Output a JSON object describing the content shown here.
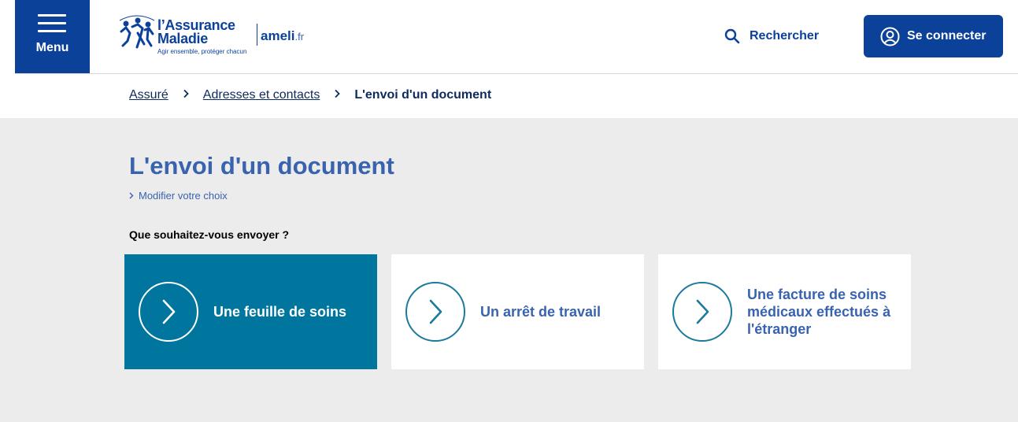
{
  "header": {
    "menu_label": "Menu",
    "logo": {
      "title_line1": "l’Assurance",
      "title_line2": "Maladie",
      "slogan": "Agir ensemble, protéger chacun",
      "ameli": "ameli",
      "ameli_suffix": ".fr"
    },
    "search_label": "Rechercher",
    "connect_label": "Se connecter"
  },
  "breadcrumb": {
    "items": [
      "Assuré",
      "Adresses et contacts"
    ],
    "current": "L'envoi d'un document"
  },
  "main": {
    "title": "L'envoi d'un document",
    "modify_link": "Modifier votre choix",
    "question": "Que souhaitez-vous envoyer ?",
    "cards": [
      {
        "label": "Une feuille de soins",
        "active": true
      },
      {
        "label": "Un arrêt de travail",
        "active": false
      },
      {
        "label": "Une facture de soins médicaux effectués à l'étranger",
        "active": false
      }
    ]
  },
  "colors": {
    "brand_blue": "#0c419a",
    "title_blue": "#3963af",
    "active_card": "#00759e",
    "background": "#ececec"
  }
}
